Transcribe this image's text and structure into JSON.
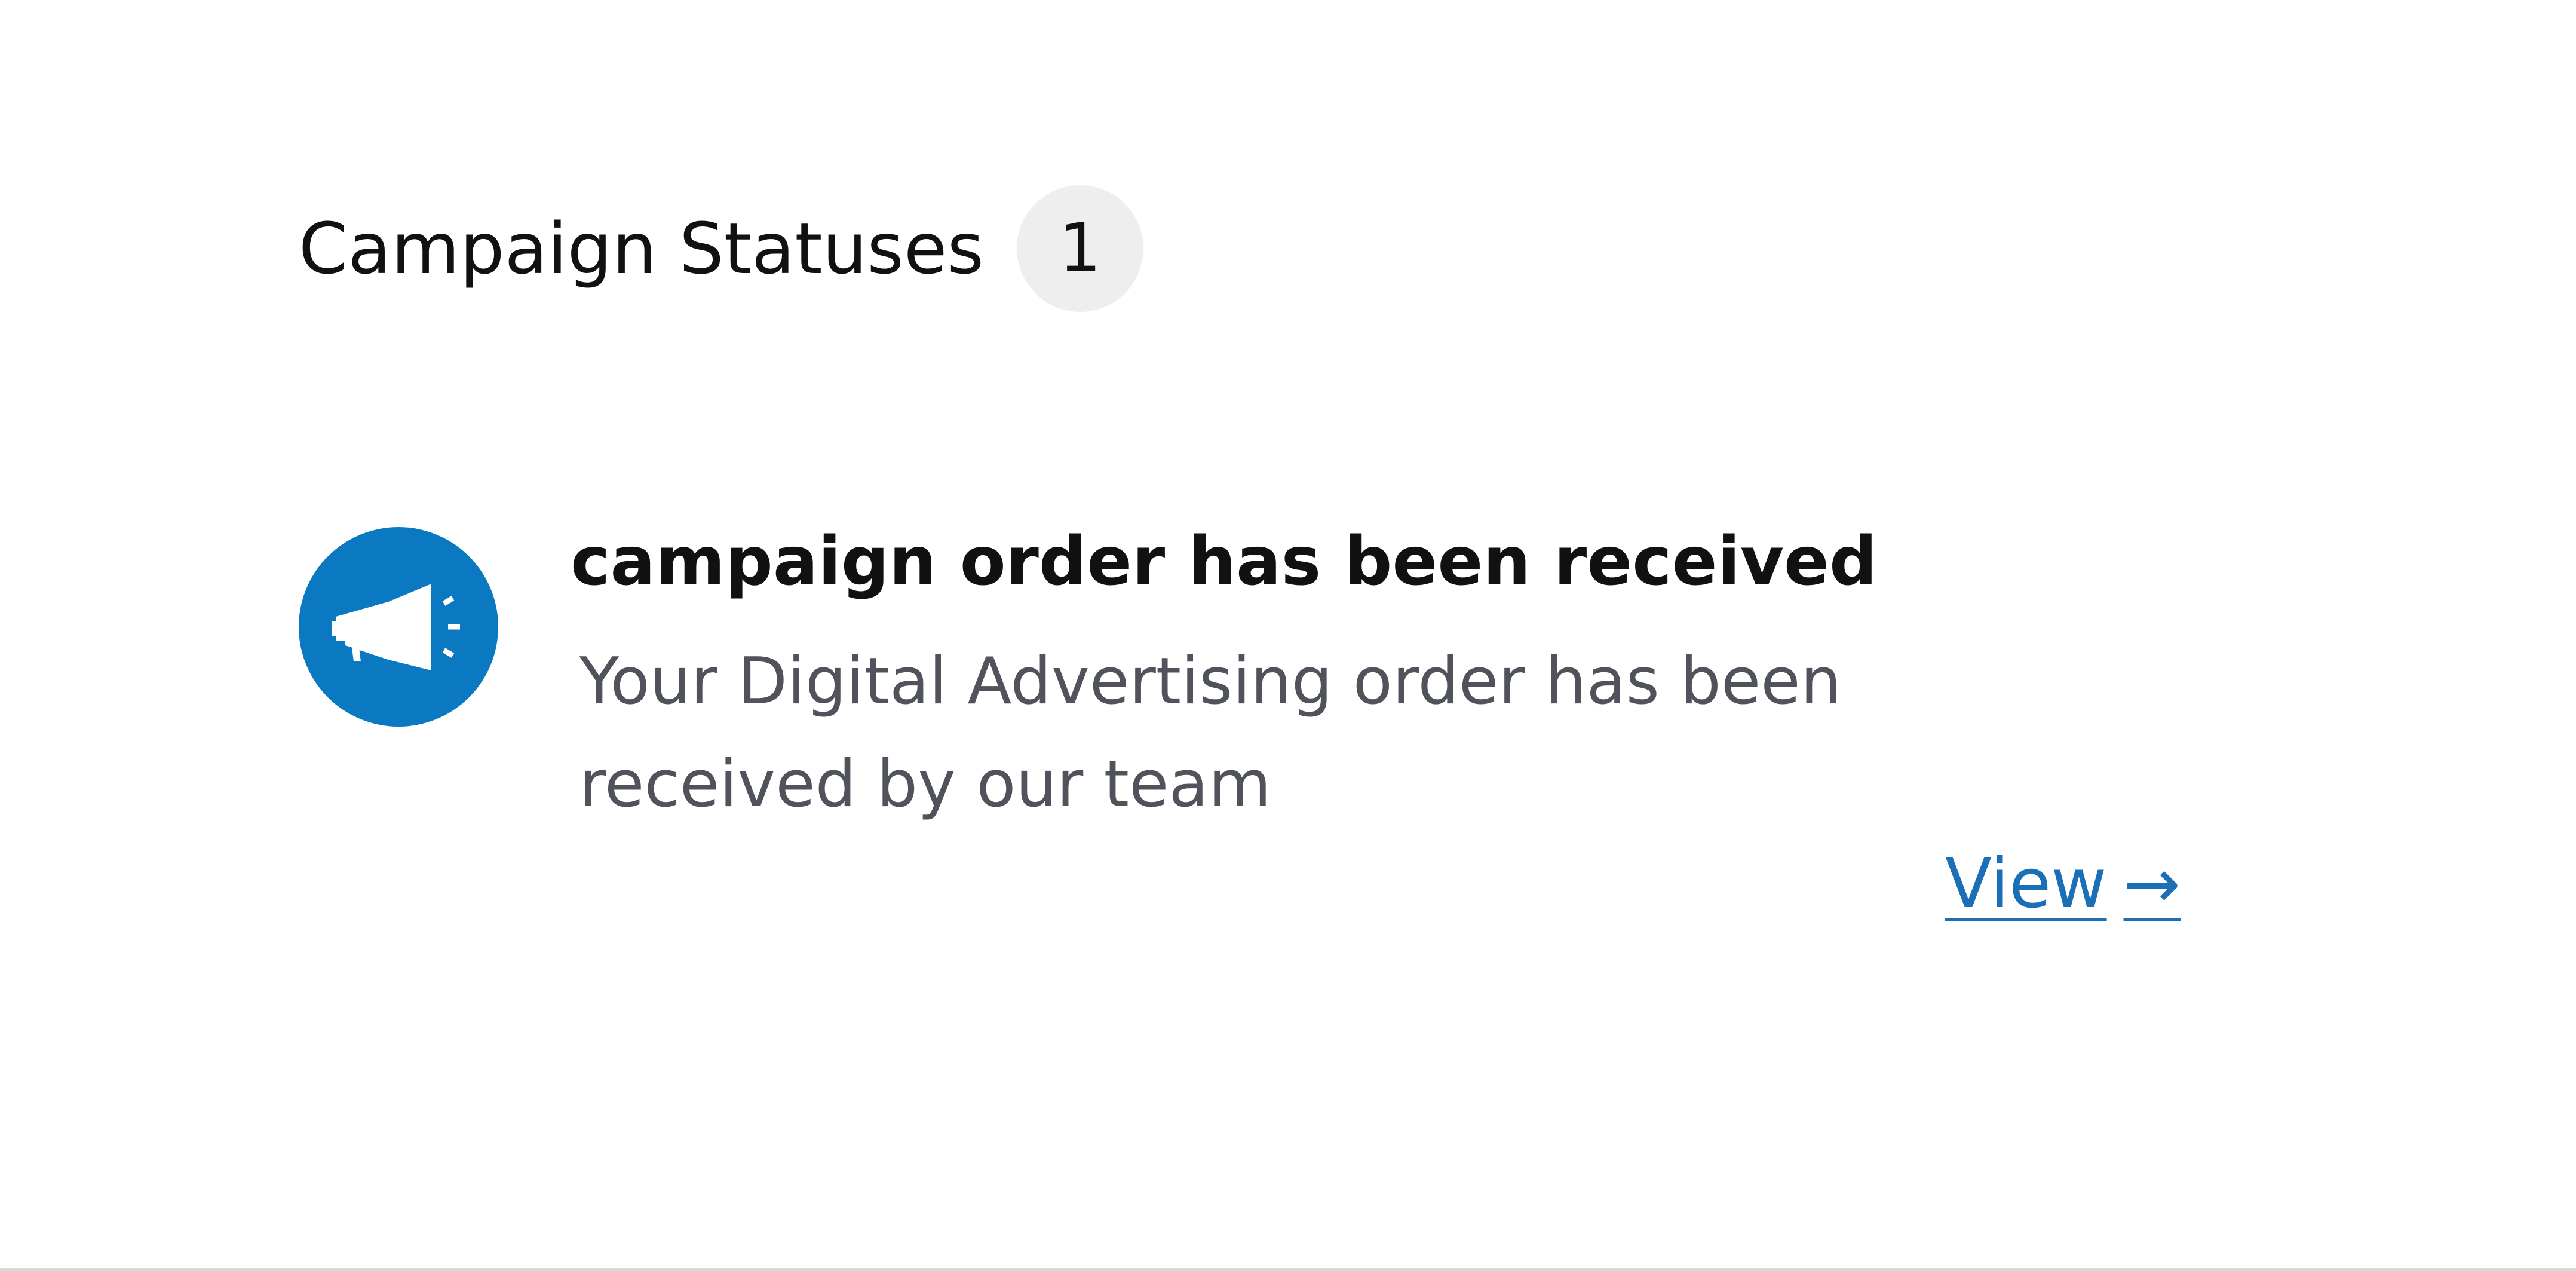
{
  "header": {
    "title": "Campaign Statuses",
    "count": "1"
  },
  "statuses": [
    {
      "icon": "megaphone-icon",
      "title": "campaign order has been received",
      "description": "Your Digital Advertising order has been received by our team",
      "link_label": "View",
      "link_arrow": "→"
    }
  ],
  "colors": {
    "accent": "#0b79c1",
    "link": "#1a6fb7",
    "badge_bg": "#eeeeee",
    "description": "#50535b"
  }
}
